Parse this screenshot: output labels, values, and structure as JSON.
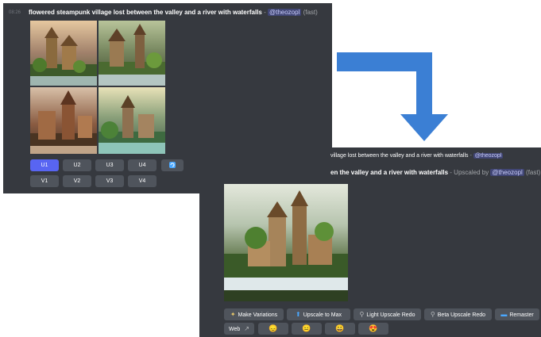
{
  "top_message": {
    "time": "08:26",
    "prompt": "flowered steampunk village lost between the valley and a river with waterfalls",
    "separator": " - ",
    "mention": "@theozopl",
    "mode": "(fast)",
    "upscale_buttons": [
      "U1",
      "U2",
      "U3",
      "U4"
    ],
    "selected_upscale": "U1",
    "refresh_icon": "refresh-icon",
    "variation_buttons": [
      "V1",
      "V2",
      "V3",
      "V4"
    ]
  },
  "bottom_message": {
    "reply_prompt": "village lost between the valley and a river with waterfalls",
    "reply_separator": " - ",
    "reply_mention": "@theozopl",
    "prompt_part": "en the valley and a river with waterfalls",
    "upscaled_by": " - Upscaled by ",
    "mention": "@theozopl",
    "mode": "(fast)",
    "actions": [
      {
        "label": "Make Variations",
        "icon": "magic-wand-icon"
      },
      {
        "label": "Upscale to Max",
        "icon": "upscale-icon"
      },
      {
        "label": "Light Upscale Redo",
        "icon": "magnifier-icon"
      },
      {
        "label": "Beta Upscale Redo",
        "icon": "magnifier-icon"
      },
      {
        "label": "Remaster",
        "icon": "remaster-icon"
      }
    ],
    "web_button": {
      "label": "Web",
      "icon": "external-link-icon"
    },
    "reactions": [
      "😞",
      "😑",
      "😀",
      "😍"
    ]
  },
  "colors": {
    "background": "#36393f",
    "button": "#4f545c",
    "selected_button": "#5865f2",
    "arrow": "#3b7fd4"
  }
}
